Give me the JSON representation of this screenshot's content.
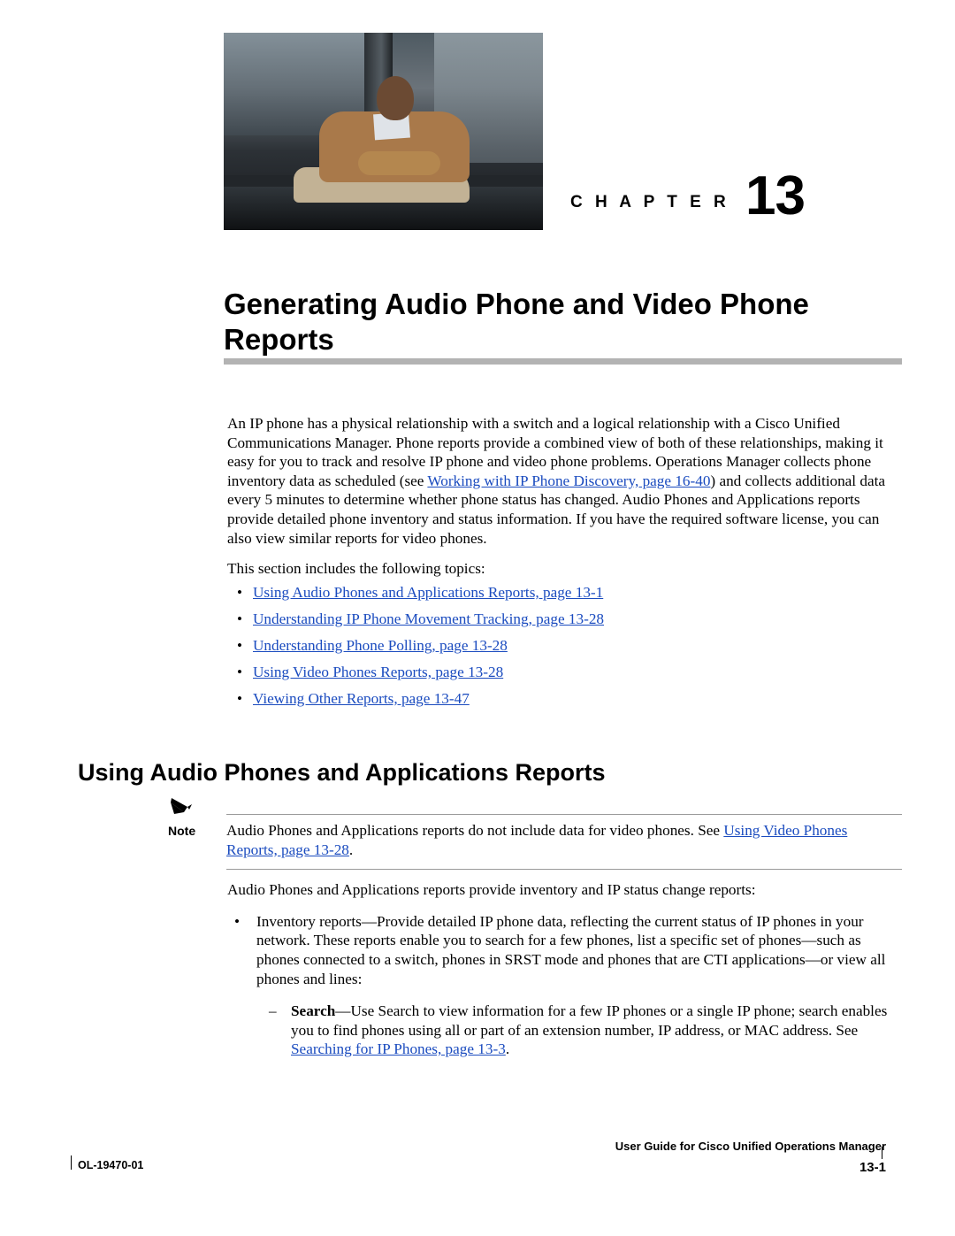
{
  "chapter": {
    "word": "C H A P T E R",
    "number": "13",
    "title_line1": "Generating Audio Phone and Video Phone",
    "title_line2": "Reports"
  },
  "intro": {
    "para1_a": "An IP phone has a physical relationship with a switch and a logical relationship with a Cisco Unified Communications Manager. Phone reports provide a combined view of both of these relationships, making it easy for you to track and resolve IP phone and video phone problems. Operations Manager collects phone inventory data as scheduled (see ",
    "para1_link": "Working with IP Phone Discovery, page 16-40",
    "para1_b": ") and collects additional data every 5 minutes to determine whether phone status has changed. Audio Phones and Applications reports provide detailed phone inventory and status information. If you have the required software license, you can also view similar reports for video phones.",
    "para2": "This section includes the following topics:"
  },
  "topics": [
    "Using Audio Phones and Applications Reports, page 13-1",
    "Understanding IP Phone Movement Tracking, page 13-28",
    "Understanding Phone Polling, page 13-28",
    "Using Video Phones Reports, page 13-28",
    "Viewing Other Reports, page 13-47"
  ],
  "section": {
    "heading": "Using Audio Phones and Applications Reports"
  },
  "note": {
    "label": "Note",
    "text_a": "Audio Phones and Applications reports do not include data for video phones. See ",
    "link": "Using Video Phones Reports, page 13-28",
    "text_b": "."
  },
  "lower": {
    "para1": "Audio Phones and Applications reports provide inventory and IP status change reports:",
    "bullet1": "Inventory reports—Provide detailed IP phone data, reflecting the current status of IP phones in your network. These reports enable you to search for a few phones, list a specific set of phones—such as phones connected to a switch, phones in SRST mode and phones that are CTI applications—or view all phones and lines:",
    "sub1_bold": "Search",
    "sub1_text": "—Use Search to view information for a few IP phones or a single IP phone; search enables you to find phones using all or part of an extension number, IP address, or MAC address. See ",
    "sub1_link": "Searching for IP Phones, page 13-3",
    "sub1_end": "."
  },
  "footer": {
    "doc_id": "OL-19470-01",
    "guide_title": "User Guide for Cisco Unified Operations Manager",
    "page_number": "13-1"
  },
  "colors": {
    "link": "#1a4bbf",
    "rule": "#b3b3b3"
  }
}
